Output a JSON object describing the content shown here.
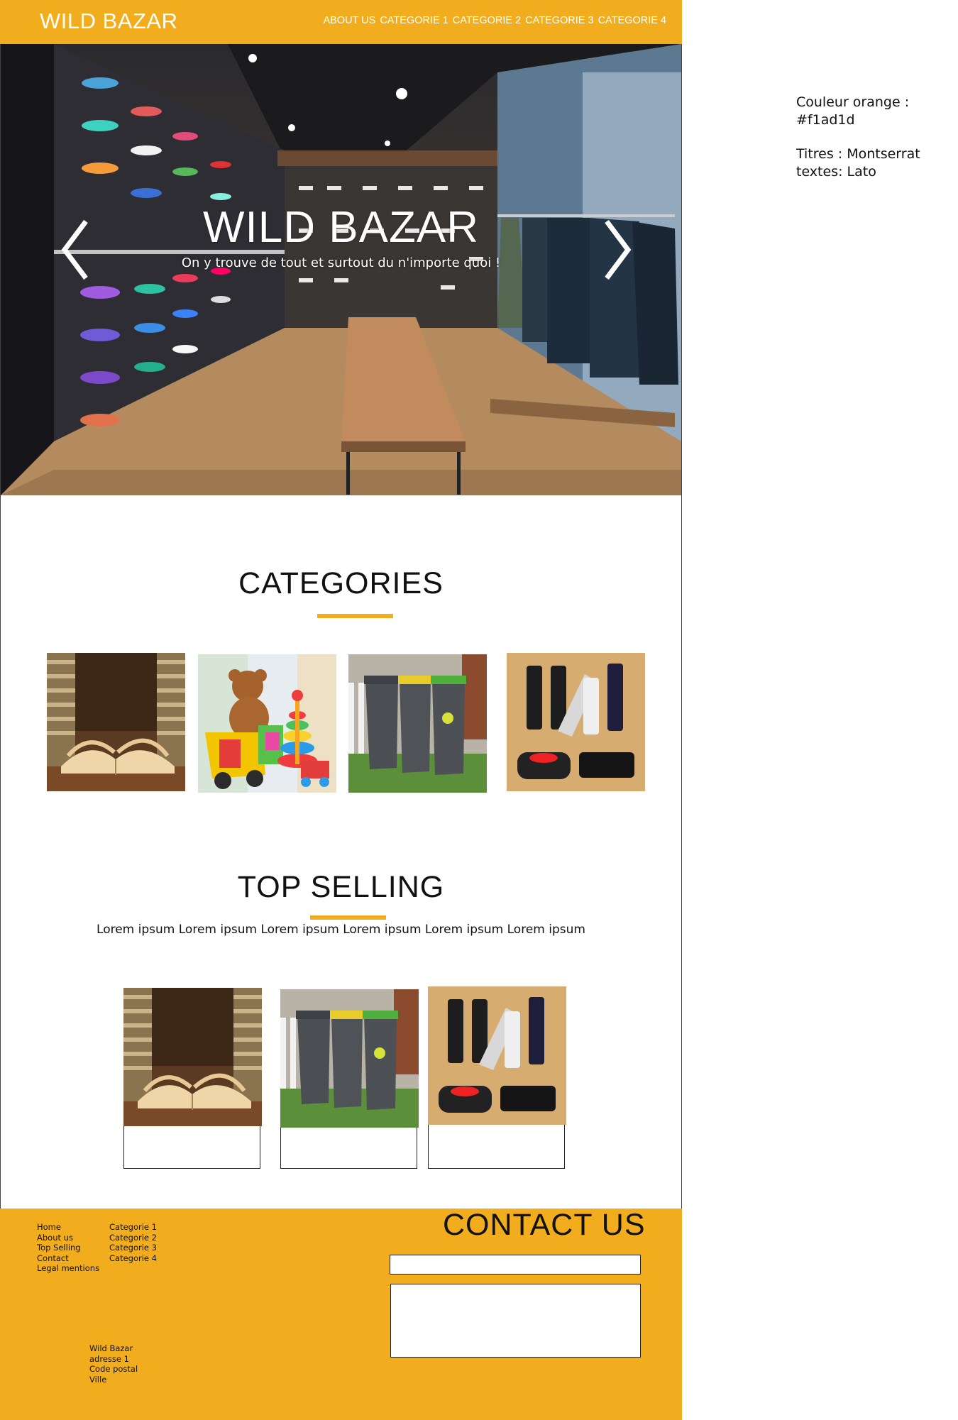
{
  "header": {
    "brand": "WILD BAZAR",
    "nav": [
      "ABOUT US",
      "CATEGORIE 1",
      "CATEGORIE 2",
      "CATEGORIE 3",
      "CATEGORIE 4"
    ]
  },
  "hero": {
    "title": "WILD BAZAR",
    "subtitle": "On y trouve de tout et surtout du n'importe quoi !",
    "prev_icon": "chevron-left-icon",
    "next_icon": "chevron-right-icon"
  },
  "categories": {
    "title": "CATEGORIES",
    "items": [
      "books-image",
      "toys-image",
      "trash-bins-image",
      "usb-keys-image"
    ]
  },
  "top_selling": {
    "title": "TOP SELLING",
    "text": "Lorem ipsum Lorem ipsum Lorem ipsum Lorem ipsum Lorem ipsum Lorem ipsum",
    "items": [
      "books-image",
      "trash-bins-image",
      "usb-keys-image"
    ]
  },
  "footer": {
    "links_col1": [
      "Home",
      "About us",
      "Top Selling",
      "Contact",
      "Legal mentions"
    ],
    "links_col2": [
      "Categorie 1",
      "Categorie 2",
      "Categorie 3",
      "Categorie 4"
    ],
    "address": [
      "Wild Bazar",
      "adresse 1",
      "Code postal",
      "Ville"
    ],
    "contact_title": "CONTACT US"
  },
  "notes": {
    "color_line": "Couleur orange : #f1ad1d",
    "titles_line": "Titres : Montserrat",
    "texts_line": "textes: Lato"
  },
  "colors": {
    "accent": "#f1ad1d"
  }
}
